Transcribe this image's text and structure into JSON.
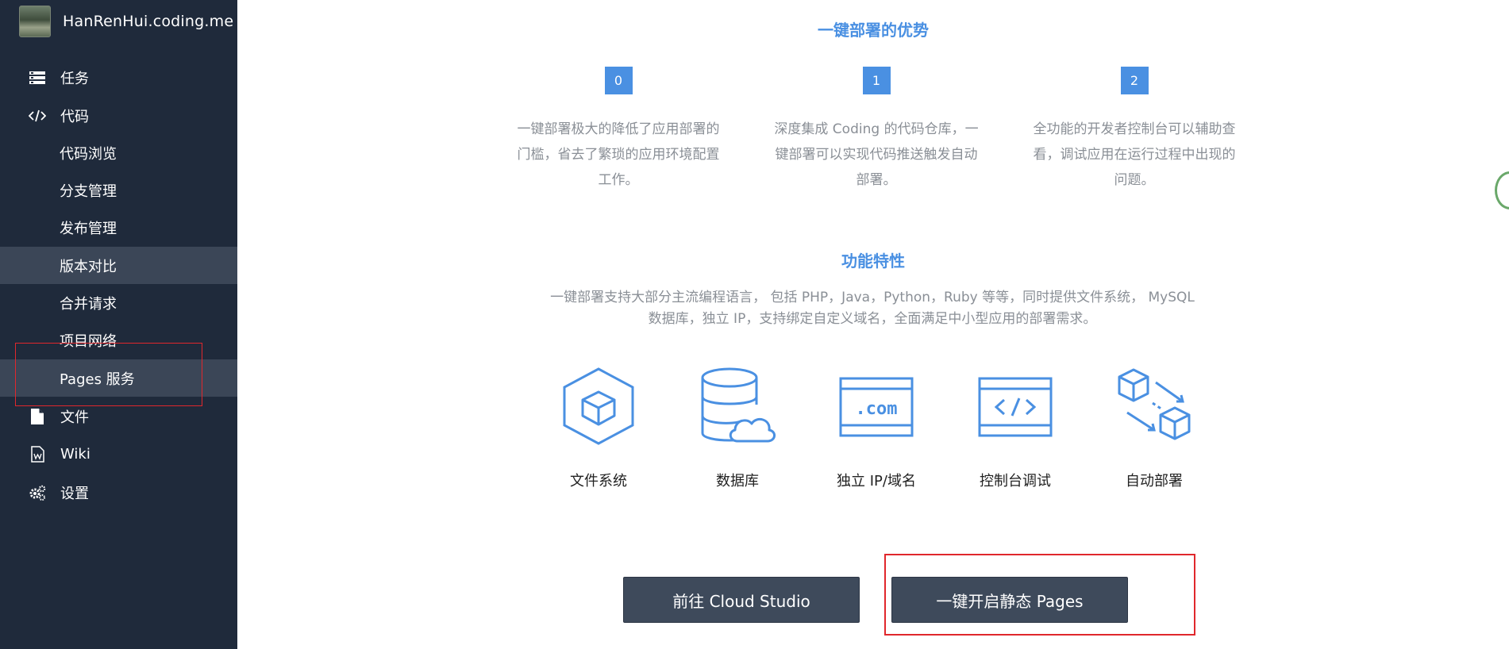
{
  "project": {
    "name": "HanRenHui.coding.me"
  },
  "sidebar": {
    "items": [
      {
        "label": "任务",
        "icon": "tasks-icon"
      },
      {
        "label": "代码",
        "icon": "code-icon"
      },
      {
        "label": "代码浏览"
      },
      {
        "label": "分支管理"
      },
      {
        "label": "发布管理"
      },
      {
        "label": "版本对比"
      },
      {
        "label": "合并请求"
      },
      {
        "label": "项目网络"
      },
      {
        "label": "Pages 服务"
      },
      {
        "label": "文件",
        "icon": "file-icon"
      },
      {
        "label": "Wiki",
        "icon": "wiki-icon"
      },
      {
        "label": "设置",
        "icon": "gears-icon"
      }
    ],
    "active_item": "版本对比"
  },
  "advantages": {
    "title": "一键部署的优势",
    "items": [
      {
        "num": "0",
        "text": "一键部署极大的降低了应用部署的门槛，省去了繁琐的应用环境配置工作。"
      },
      {
        "num": "1",
        "text": "深度集成 Coding 的代码仓库，一键部署可以实现代码推送触发自动部署。"
      },
      {
        "num": "2",
        "text": "全功能的开发者控制台可以辅助查看，调试应用在运行过程中出现的问题。"
      }
    ]
  },
  "features": {
    "title": "功能特性",
    "description": "一键部署支持大部分主流编程语言， 包括 PHP，Java，Python，Ruby 等等，同时提供文件系统， MySQL 数据库，独立 IP，支持绑定自定义域名，全面满足中小型应用的部署需求。",
    "items": [
      {
        "label": "文件系统",
        "icon": "hexagon-cube-icon"
      },
      {
        "label": "数据库",
        "icon": "database-cloud-icon"
      },
      {
        "label": "独立 IP/域名",
        "icon": "dotcom-icon"
      },
      {
        "label": "控制台调试",
        "icon": "code-window-icon"
      },
      {
        "label": "自动部署",
        "icon": "auto-deploy-icon"
      }
    ]
  },
  "buttons": {
    "cloud_studio": "前往 Cloud Studio",
    "enable_pages": "一键开启静态 Pages"
  },
  "colors": {
    "sidebar_bg": "#1f2a3b",
    "accent": "#4a90e2",
    "button_bg": "#3e4a5b",
    "highlight_red": "#e0272c"
  }
}
